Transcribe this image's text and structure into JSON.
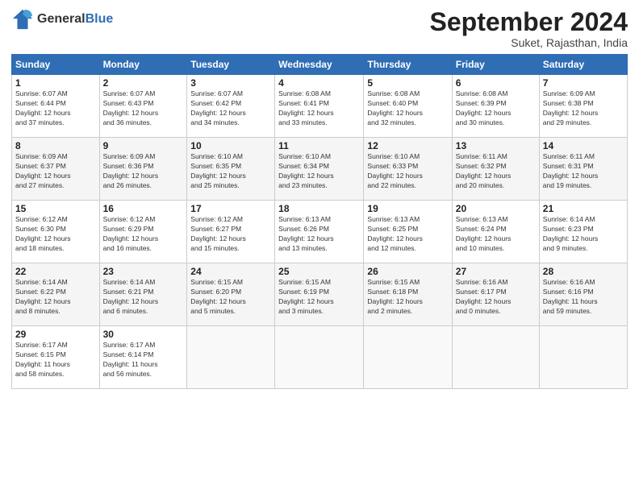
{
  "header": {
    "logo_general": "General",
    "logo_blue": "Blue",
    "month_title": "September 2024",
    "location": "Suket, Rajasthan, India"
  },
  "calendar": {
    "days_of_week": [
      "Sunday",
      "Monday",
      "Tuesday",
      "Wednesday",
      "Thursday",
      "Friday",
      "Saturday"
    ],
    "weeks": [
      [
        {
          "day": "1",
          "info": "Sunrise: 6:07 AM\nSunset: 6:44 PM\nDaylight: 12 hours\nand 37 minutes."
        },
        {
          "day": "2",
          "info": "Sunrise: 6:07 AM\nSunset: 6:43 PM\nDaylight: 12 hours\nand 36 minutes."
        },
        {
          "day": "3",
          "info": "Sunrise: 6:07 AM\nSunset: 6:42 PM\nDaylight: 12 hours\nand 34 minutes."
        },
        {
          "day": "4",
          "info": "Sunrise: 6:08 AM\nSunset: 6:41 PM\nDaylight: 12 hours\nand 33 minutes."
        },
        {
          "day": "5",
          "info": "Sunrise: 6:08 AM\nSunset: 6:40 PM\nDaylight: 12 hours\nand 32 minutes."
        },
        {
          "day": "6",
          "info": "Sunrise: 6:08 AM\nSunset: 6:39 PM\nDaylight: 12 hours\nand 30 minutes."
        },
        {
          "day": "7",
          "info": "Sunrise: 6:09 AM\nSunset: 6:38 PM\nDaylight: 12 hours\nand 29 minutes."
        }
      ],
      [
        {
          "day": "8",
          "info": "Sunrise: 6:09 AM\nSunset: 6:37 PM\nDaylight: 12 hours\nand 27 minutes."
        },
        {
          "day": "9",
          "info": "Sunrise: 6:09 AM\nSunset: 6:36 PM\nDaylight: 12 hours\nand 26 minutes."
        },
        {
          "day": "10",
          "info": "Sunrise: 6:10 AM\nSunset: 6:35 PM\nDaylight: 12 hours\nand 25 minutes."
        },
        {
          "day": "11",
          "info": "Sunrise: 6:10 AM\nSunset: 6:34 PM\nDaylight: 12 hours\nand 23 minutes."
        },
        {
          "day": "12",
          "info": "Sunrise: 6:10 AM\nSunset: 6:33 PM\nDaylight: 12 hours\nand 22 minutes."
        },
        {
          "day": "13",
          "info": "Sunrise: 6:11 AM\nSunset: 6:32 PM\nDaylight: 12 hours\nand 20 minutes."
        },
        {
          "day": "14",
          "info": "Sunrise: 6:11 AM\nSunset: 6:31 PM\nDaylight: 12 hours\nand 19 minutes."
        }
      ],
      [
        {
          "day": "15",
          "info": "Sunrise: 6:12 AM\nSunset: 6:30 PM\nDaylight: 12 hours\nand 18 minutes."
        },
        {
          "day": "16",
          "info": "Sunrise: 6:12 AM\nSunset: 6:29 PM\nDaylight: 12 hours\nand 16 minutes."
        },
        {
          "day": "17",
          "info": "Sunrise: 6:12 AM\nSunset: 6:27 PM\nDaylight: 12 hours\nand 15 minutes."
        },
        {
          "day": "18",
          "info": "Sunrise: 6:13 AM\nSunset: 6:26 PM\nDaylight: 12 hours\nand 13 minutes."
        },
        {
          "day": "19",
          "info": "Sunrise: 6:13 AM\nSunset: 6:25 PM\nDaylight: 12 hours\nand 12 minutes."
        },
        {
          "day": "20",
          "info": "Sunrise: 6:13 AM\nSunset: 6:24 PM\nDaylight: 12 hours\nand 10 minutes."
        },
        {
          "day": "21",
          "info": "Sunrise: 6:14 AM\nSunset: 6:23 PM\nDaylight: 12 hours\nand 9 minutes."
        }
      ],
      [
        {
          "day": "22",
          "info": "Sunrise: 6:14 AM\nSunset: 6:22 PM\nDaylight: 12 hours\nand 8 minutes."
        },
        {
          "day": "23",
          "info": "Sunrise: 6:14 AM\nSunset: 6:21 PM\nDaylight: 12 hours\nand 6 minutes."
        },
        {
          "day": "24",
          "info": "Sunrise: 6:15 AM\nSunset: 6:20 PM\nDaylight: 12 hours\nand 5 minutes."
        },
        {
          "day": "25",
          "info": "Sunrise: 6:15 AM\nSunset: 6:19 PM\nDaylight: 12 hours\nand 3 minutes."
        },
        {
          "day": "26",
          "info": "Sunrise: 6:15 AM\nSunset: 6:18 PM\nDaylight: 12 hours\nand 2 minutes."
        },
        {
          "day": "27",
          "info": "Sunrise: 6:16 AM\nSunset: 6:17 PM\nDaylight: 12 hours\nand 0 minutes."
        },
        {
          "day": "28",
          "info": "Sunrise: 6:16 AM\nSunset: 6:16 PM\nDaylight: 11 hours\nand 59 minutes."
        }
      ],
      [
        {
          "day": "29",
          "info": "Sunrise: 6:17 AM\nSunset: 6:15 PM\nDaylight: 11 hours\nand 58 minutes."
        },
        {
          "day": "30",
          "info": "Sunrise: 6:17 AM\nSunset: 6:14 PM\nDaylight: 11 hours\nand 56 minutes."
        },
        {
          "day": "",
          "info": ""
        },
        {
          "day": "",
          "info": ""
        },
        {
          "day": "",
          "info": ""
        },
        {
          "day": "",
          "info": ""
        },
        {
          "day": "",
          "info": ""
        }
      ]
    ]
  }
}
